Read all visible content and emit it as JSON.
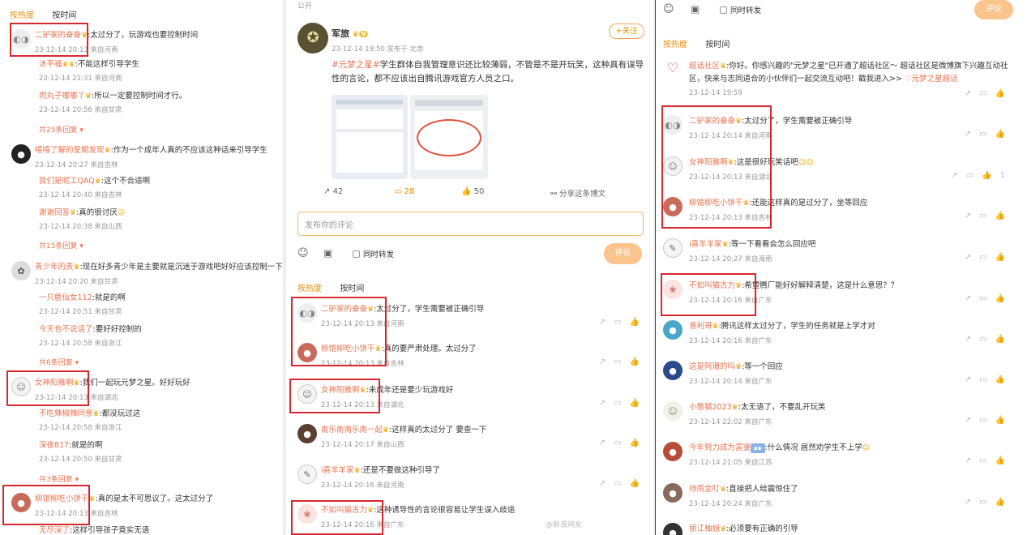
{
  "left": {
    "sort": {
      "hot": "按热度",
      "time": "按时间"
    },
    "comments": [
      {
        "name": "二驴家的奋奋",
        "text": ":太过分了，玩游戏也要控制时间",
        "meta": "23-12-14 20:13 来自河南",
        "replies": [
          {
            "name": "沐平福",
            "text": ":不能这样引导学生",
            "meta": "23-12-14 21:31 来自河南"
          },
          {
            "name": "肉丸子嘟嘟丫",
            "text": ":所以一定要控制时间才行。",
            "meta": "23-12-14 20:56 来自甘肃"
          }
        ],
        "more": "共25条回复"
      },
      {
        "name": "嘻嘻了解的星期发现",
        "text": ":作为一个成年人真的不应该这种话来引导学生",
        "meta": "23-12-14 20:27 来自吉林",
        "replies": [
          {
            "name": "我们是呢工QAQ",
            "text": ":这个不合适啊",
            "meta": "23-12-14 20:40 来自吉林"
          },
          {
            "name": "谢谢回答",
            "text": ":真的很讨厌",
            "meta": "23-12-14 20:38 来自山西"
          }
        ],
        "more": "共15条回复"
      },
      {
        "name": "青少年的责",
        "text": ":现在好多青少年是主要就是沉迷于游戏吧好好应该控制一下",
        "meta": "23-12-14 20:20 来自甘肃",
        "replies": [
          {
            "name": "一只鹿仙女112",
            "text": ":就是的啊",
            "meta": "23-12-14 20:51 来自甘肃"
          },
          {
            "name": "今天也不说话了",
            "text": ":要好好控制的",
            "meta": "23-12-14 20:58 来自浙江"
          }
        ],
        "more": "共6条回复"
      },
      {
        "name": "女神阳雅啊",
        "text": ":我们一起玩元梦之星。好好玩好",
        "meta": "23-12-14 20:13 来自湖北",
        "replies": [
          {
            "name": "不吃辣椒辣同意",
            "text": ":都没玩过这",
            "meta": "23-12-14 20:58 来自浙江"
          },
          {
            "name": "深夜817",
            "text": ":就是的啊",
            "meta": "23-12-14 20:50 来自甘肃"
          }
        ],
        "more": "共3条回复"
      },
      {
        "name": "柳馆柳吃小饼干",
        "text": ":真的是太不可思议了。这太过分了",
        "meta": "23-12-14 20:13 来自吉林",
        "replies": [
          {
            "name": "无尽深了",
            "text": ":这样引导孩子竟实无语",
            "meta": ""
          }
        ],
        "more": ""
      }
    ]
  },
  "middle": {
    "top_label": "公开",
    "post": {
      "author": "军旅",
      "meta": "23-12-14 19:50 发布于 北京",
      "follow": "+关注",
      "tag": "#元梦之星#",
      "text": "学生群体自我管理意识还比较薄弱，不管是不是开玩笑，这种具有误导性的言论，都不应该出自腾讯游戏官方人员之口。",
      "stats": {
        "repost": "42",
        "comment": "28",
        "like": "50",
        "share": "分享这条博文"
      }
    },
    "input_placeholder": "发布你的评论",
    "also_repost": "同时转发",
    "submit": "评论",
    "sort": {
      "hot": "按热度",
      "time": "按时间"
    },
    "comments": [
      {
        "name": "二驴家的奋奋",
        "text": ":太过分了，学生需要被正确引导",
        "meta": "23-12-14 20:13 来自河南"
      },
      {
        "name": "柳馆柳吃小饼干",
        "text": ":真的要严肃处理。太过分了",
        "meta": "23-12-14 20:13 来自吉林"
      },
      {
        "name": "女神阳雅啊",
        "text": ":未成年还是要少玩游戏好",
        "meta": "23-12-14 20:13 来自湖北"
      },
      {
        "name": "南乐南南乐南一起",
        "text": ":这样真的太过分了 要查一下",
        "meta": "23-12-14 20:17 来自山西"
      },
      {
        "name": "i喜羊羊家",
        "text": ":还是不要做这种引导了",
        "meta": "23-12-14 20:16 来自河南"
      },
      {
        "name": "不如叫猫古力",
        "text": ":这种诱导性的言论很容易让学生误入歧途",
        "meta": "23-12-14 20:16 来自广东"
      }
    ],
    "watermark": "@新浪网友"
  },
  "right": {
    "also_repost": "同时转发",
    "submit": "评论",
    "sort": {
      "hot": "按热度",
      "time": "按时间"
    },
    "comments": [
      {
        "name": "超话社区",
        "text": ":你好。你感兴趣的\"元梦之星\"已开通了超话社区～ 超话社区是微博旗下兴趣互动社区，快来与志同道合的小伙伴们一起交流互动吧！戳我进入>> ",
        "link": "元梦之星超话",
        "meta": "23-12-14 19:59"
      },
      {
        "name": "二驴家的奋奋",
        "text": ":太过分了，学生需要被正确引导",
        "meta": "23-12-14 20:14 来自河南"
      },
      {
        "name": "女神阳雅啊",
        "text": ":这是很好玩笑话吧",
        "meta": "23-12-14 20:13 来自湖北",
        "like": "1"
      },
      {
        "name": "柳馆柳吃小饼干",
        "text": ":还能这样真的是过分了，坐等回应",
        "meta": "23-12-14 20:13 来自吉林"
      },
      {
        "name": "i喜羊羊家",
        "text": ":等一下看看会怎么回应吧",
        "meta": "23-12-14 20:27 来自海南"
      },
      {
        "name": "不如叫猫古力",
        "text": ":希望腾厂能好好解释清楚，这是什么意思？？",
        "meta": "23-12-14 20:16 来自广东"
      },
      {
        "name": "渔利哥",
        "text": ":腾讯这样太过分了，学生的任务就是上学才对",
        "meta": "23-12-14 20:16 来自广东"
      },
      {
        "name": "这是阿珊的吗",
        "text": ":等一个回应",
        "meta": "23-12-14 20:14 来自广东"
      },
      {
        "name": "小憨猫2023",
        "text": ":太无语了，不要乱开玩笑",
        "meta": "23-12-14 22:02 来自广东"
      },
      {
        "name": "今年努力成为富婆",
        "text": ":什么情况 居然劝学生不上学",
        "meta": "23-12-14 21:05 来自江苏"
      },
      {
        "name": "待雨金叮",
        "text": ":直接把人给震惊住了",
        "meta": "23-12-14 20:24 来自广东"
      },
      {
        "name": "丽江柚姐",
        "text": ":必须要有正确的引导",
        "meta": ""
      }
    ]
  }
}
